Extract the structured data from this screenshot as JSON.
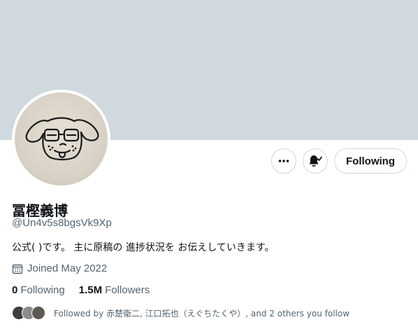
{
  "profile": {
    "name": "冨樫義博",
    "handle": "@Un4v5s8bgsVk9Xp",
    "bio": "公式( )です。 主に原稿の 進捗状況を お伝えしていきます。",
    "joined": "Joined May 2022"
  },
  "actions": {
    "more_icon": "more-icon",
    "notify_icon": "bell-subscribed-icon",
    "following_label": "Following"
  },
  "stats": {
    "following_count": "0",
    "following_label": "Following",
    "followers_count": "1.5M",
    "followers_label": "Followers"
  },
  "followed_by": {
    "text": "Followed by 赤楚衛二, 江口拓也（えぐちたくや）, and 2 others you follow"
  },
  "colors": {
    "banner": "#cfd9de",
    "secondary_text": "#536471",
    "border": "#cfd9de"
  }
}
